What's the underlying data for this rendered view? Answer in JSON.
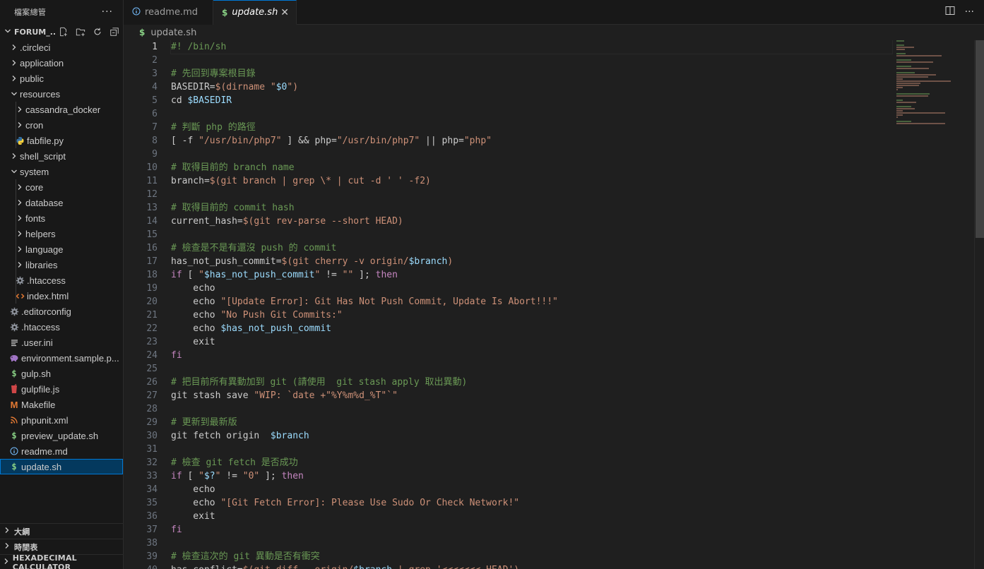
{
  "sidebar": {
    "title": "檔案總管",
    "more": "···",
    "folder_name": "FORUM_...",
    "items": [
      {
        "label": ".circleci",
        "type": "folder",
        "depth": 1,
        "expanded": false
      },
      {
        "label": "application",
        "type": "folder",
        "depth": 1,
        "expanded": false
      },
      {
        "label": "public",
        "type": "folder",
        "depth": 1,
        "expanded": false
      },
      {
        "label": "resources",
        "type": "folder",
        "depth": 1,
        "expanded": true
      },
      {
        "label": "cassandra_docker",
        "type": "folder",
        "depth": 2,
        "expanded": false
      },
      {
        "label": "cron",
        "type": "folder",
        "depth": 2,
        "expanded": false
      },
      {
        "label": "fabfile.py",
        "type": "python",
        "depth": 2
      },
      {
        "label": "shell_script",
        "type": "folder",
        "depth": 1,
        "expanded": false
      },
      {
        "label": "system",
        "type": "folder",
        "depth": 1,
        "expanded": true
      },
      {
        "label": "core",
        "type": "folder",
        "depth": 2,
        "expanded": false
      },
      {
        "label": "database",
        "type": "folder",
        "depth": 2,
        "expanded": false
      },
      {
        "label": "fonts",
        "type": "folder",
        "depth": 2,
        "expanded": false
      },
      {
        "label": "helpers",
        "type": "folder",
        "depth": 2,
        "expanded": false
      },
      {
        "label": "language",
        "type": "folder",
        "depth": 2,
        "expanded": false
      },
      {
        "label": "libraries",
        "type": "folder",
        "depth": 2,
        "expanded": false
      },
      {
        "label": ".htaccess",
        "type": "gear",
        "depth": 2
      },
      {
        "label": "index.html",
        "type": "html",
        "depth": 2
      },
      {
        "label": ".editorconfig",
        "type": "gear",
        "depth": 1
      },
      {
        "label": ".htaccess",
        "type": "gear",
        "depth": 1
      },
      {
        "label": ".user.ini",
        "type": "lines",
        "depth": 1
      },
      {
        "label": "environment.sample.p...",
        "type": "php",
        "depth": 1
      },
      {
        "label": "gulp.sh",
        "type": "shell",
        "depth": 1
      },
      {
        "label": "gulpfile.js",
        "type": "gulp",
        "depth": 1
      },
      {
        "label": "Makefile",
        "type": "makefile",
        "depth": 1
      },
      {
        "label": "phpunit.xml",
        "type": "rss",
        "depth": 1
      },
      {
        "label": "preview_update.sh",
        "type": "shell",
        "depth": 1
      },
      {
        "label": "readme.md",
        "type": "info",
        "depth": 1
      },
      {
        "label": "update.sh",
        "type": "shell",
        "depth": 1,
        "selected": true
      }
    ],
    "bottom_sections": [
      "大綱",
      "時間表",
      "HEXADECIMAL CALCULATOR"
    ]
  },
  "tabs": [
    {
      "label": "readme.md",
      "icon": "info-icon",
      "active": false
    },
    {
      "label": "update.sh",
      "icon": "shell-icon",
      "active": true,
      "close": "✕"
    }
  ],
  "breadcrumb": {
    "icon": "$",
    "file": "update.sh"
  },
  "editor": {
    "current_line": 1,
    "lines": [
      [
        [
          "c-com",
          "#! /bin/sh"
        ]
      ],
      [],
      [
        [
          "c-com",
          "# 先回到專案根目錄"
        ]
      ],
      [
        [
          "",
          "BASEDIR="
        ],
        [
          "c-sh",
          "$(dirname "
        ],
        [
          "c-str",
          "\""
        ],
        [
          "c-var",
          "$0"
        ],
        [
          "c-str",
          "\""
        ],
        [
          "c-sh",
          ")"
        ]
      ],
      [
        [
          "",
          "cd "
        ],
        [
          "c-var",
          "$BASEDIR"
        ]
      ],
      [],
      [
        [
          "c-com",
          "# 判斷 php 的路徑"
        ]
      ],
      [
        [
          "",
          "[ -f "
        ],
        [
          "c-str",
          "\"/usr/bin/php7\""
        ],
        [
          "",
          " ] && php="
        ],
        [
          "c-str",
          "\"/usr/bin/php7\""
        ],
        [
          "",
          " || php="
        ],
        [
          "c-str",
          "\"php\""
        ]
      ],
      [],
      [
        [
          "c-com",
          "# 取得目前的 branch name"
        ]
      ],
      [
        [
          "",
          "branch="
        ],
        [
          "c-sh",
          "$(git branch | grep \\* | cut -d ' ' -f2)"
        ]
      ],
      [],
      [
        [
          "c-com",
          "# 取得目前的 commit hash"
        ]
      ],
      [
        [
          "",
          "current_hash="
        ],
        [
          "c-sh",
          "$(git rev-parse --short HEAD)"
        ]
      ],
      [],
      [
        [
          "c-com",
          "# 檢查是不是有還沒 push 的 commit"
        ]
      ],
      [
        [
          "",
          "has_not_push_commit="
        ],
        [
          "c-sh",
          "$(git cherry -v origin/"
        ],
        [
          "c-var",
          "$branch"
        ],
        [
          "c-sh",
          ")"
        ]
      ],
      [
        [
          "c-kw",
          "if"
        ],
        [
          "",
          " [ "
        ],
        [
          "c-str",
          "\""
        ],
        [
          "c-var",
          "$has_not_push_commit"
        ],
        [
          "c-str",
          "\""
        ],
        [
          "",
          " != "
        ],
        [
          "c-str",
          "\"\""
        ],
        [
          "",
          " ]; "
        ],
        [
          "c-kw",
          "then"
        ]
      ],
      [
        [
          "",
          "    echo"
        ]
      ],
      [
        [
          "",
          "    echo "
        ],
        [
          "c-str",
          "\"[Update Error]: Git Has Not Push Commit, Update Is Abort!!!\""
        ]
      ],
      [
        [
          "",
          "    echo "
        ],
        [
          "c-str",
          "\"No Push Git Commits:\""
        ]
      ],
      [
        [
          "",
          "    echo "
        ],
        [
          "c-var",
          "$has_not_push_commit"
        ]
      ],
      [
        [
          "",
          "    exit"
        ]
      ],
      [
        [
          "c-kw",
          "fi"
        ]
      ],
      [],
      [
        [
          "c-com",
          "# 把目前所有異動加到 git (請使用  git stash apply 取出異動)"
        ]
      ],
      [
        [
          "",
          "git stash save "
        ],
        [
          "c-str",
          "\"WIP: `date +\"%Y%m%d_%T\"`\""
        ]
      ],
      [],
      [
        [
          "c-com",
          "# 更新到最新版"
        ]
      ],
      [
        [
          "",
          "git fetch origin  "
        ],
        [
          "c-var",
          "$branch"
        ]
      ],
      [],
      [
        [
          "c-com",
          "# 檢查 git fetch 是否成功"
        ]
      ],
      [
        [
          "c-kw",
          "if"
        ],
        [
          "",
          " [ "
        ],
        [
          "c-str",
          "\""
        ],
        [
          "c-var",
          "$?"
        ],
        [
          "c-str",
          "\""
        ],
        [
          "",
          " != "
        ],
        [
          "c-str",
          "\"0\""
        ],
        [
          "",
          " ]; "
        ],
        [
          "c-kw",
          "then"
        ]
      ],
      [
        [
          "",
          "    echo"
        ]
      ],
      [
        [
          "",
          "    echo "
        ],
        [
          "c-str",
          "\"[Git Fetch Error]: Please Use Sudo Or Check Network!\""
        ]
      ],
      [
        [
          "",
          "    exit"
        ]
      ],
      [
        [
          "c-kw",
          "fi"
        ]
      ],
      [],
      [
        [
          "c-com",
          "# 檢查這次的 git 異動是否有衝突"
        ]
      ],
      [
        [
          "",
          "has_conflict="
        ],
        [
          "c-sh",
          "$(git diff ..origin/"
        ],
        [
          "c-var",
          "$branch"
        ],
        [
          "c-sh",
          " | grep '<<<<<<< HEAD')"
        ]
      ]
    ]
  },
  "colors": {
    "accent": "#0078d4",
    "selection_bg": "#04395e",
    "comment": "#6a9955",
    "string": "#ce9178",
    "variable": "#9cdcfe",
    "keyword": "#c586c0",
    "shell_icon": "#89d185"
  }
}
